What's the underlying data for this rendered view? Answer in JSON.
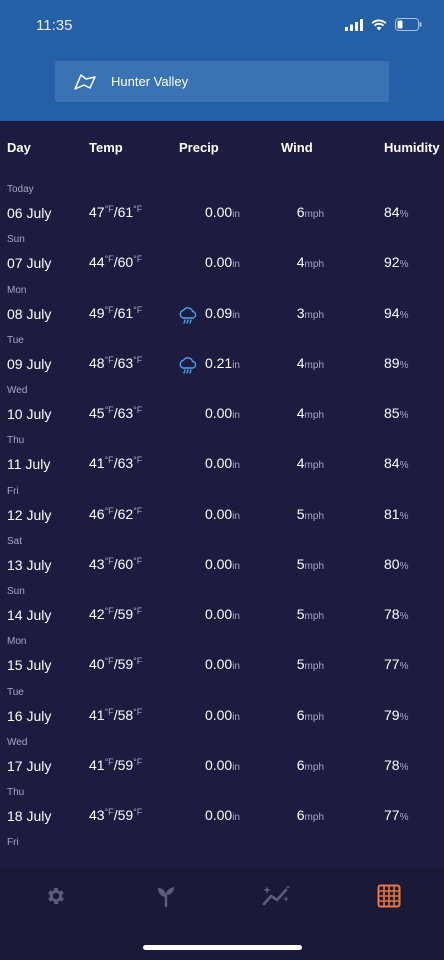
{
  "status_bar": {
    "time": "11:35"
  },
  "location": {
    "name": "Hunter Valley"
  },
  "table": {
    "headers": {
      "day": "Day",
      "temp": "Temp",
      "precip": "Precip",
      "wind": "Wind",
      "humidity": "Humidity"
    },
    "units": {
      "temp": "°F",
      "precip": "in",
      "wind": "mph",
      "humidity": "%"
    },
    "rows": [
      {
        "weekday": "Today",
        "date": "06 July",
        "high": "47",
        "low": "61",
        "precip": "0.00",
        "rain": false,
        "wind": "6",
        "humidity": "84"
      },
      {
        "weekday": "Sun",
        "date": "07 July",
        "high": "44",
        "low": "60",
        "precip": "0.00",
        "rain": false,
        "wind": "4",
        "humidity": "92"
      },
      {
        "weekday": "Mon",
        "date": "08 July",
        "high": "49",
        "low": "61",
        "precip": "0.09",
        "rain": true,
        "wind": "3",
        "humidity": "94"
      },
      {
        "weekday": "Tue",
        "date": "09 July",
        "high": "48",
        "low": "63",
        "precip": "0.21",
        "rain": true,
        "wind": "4",
        "humidity": "89"
      },
      {
        "weekday": "Wed",
        "date": "10 July",
        "high": "45",
        "low": "63",
        "precip": "0.00",
        "rain": false,
        "wind": "4",
        "humidity": "85"
      },
      {
        "weekday": "Thu",
        "date": "11 July",
        "high": "41",
        "low": "63",
        "precip": "0.00",
        "rain": false,
        "wind": "4",
        "humidity": "84"
      },
      {
        "weekday": "Fri",
        "date": "12 July",
        "high": "46",
        "low": "62",
        "precip": "0.00",
        "rain": false,
        "wind": "5",
        "humidity": "81"
      },
      {
        "weekday": "Sat",
        "date": "13 July",
        "high": "43",
        "low": "60",
        "precip": "0.00",
        "rain": false,
        "wind": "5",
        "humidity": "80"
      },
      {
        "weekday": "Sun",
        "date": "14 July",
        "high": "42",
        "low": "59",
        "precip": "0.00",
        "rain": false,
        "wind": "5",
        "humidity": "78"
      },
      {
        "weekday": "Mon",
        "date": "15 July",
        "high": "40",
        "low": "59",
        "precip": "0.00",
        "rain": false,
        "wind": "5",
        "humidity": "77"
      },
      {
        "weekday": "Tue",
        "date": "16 July",
        "high": "41",
        "low": "58",
        "precip": "0.00",
        "rain": false,
        "wind": "6",
        "humidity": "79"
      },
      {
        "weekday": "Wed",
        "date": "17 July",
        "high": "41",
        "low": "59",
        "precip": "0.00",
        "rain": false,
        "wind": "6",
        "humidity": "78"
      },
      {
        "weekday": "Thu",
        "date": "18 July",
        "high": "43",
        "low": "59",
        "precip": "0.00",
        "rain": false,
        "wind": "6",
        "humidity": "77"
      }
    ],
    "trailing_weekday": "Fri"
  },
  "tabs": [
    {
      "name": "settings",
      "icon": "gear-icon",
      "active": false
    },
    {
      "name": "growth",
      "icon": "sprout-icon",
      "active": false
    },
    {
      "name": "trends",
      "icon": "sparkle-chart-icon",
      "active": false
    },
    {
      "name": "table",
      "icon": "grid-icon",
      "active": true
    }
  ],
  "colors": {
    "header": "#2560a6",
    "background": "#1c1a3f",
    "active_tab": "#e8793a",
    "inactive_tab": "#5c5b80",
    "rain_icon": "#4aa3e8"
  }
}
